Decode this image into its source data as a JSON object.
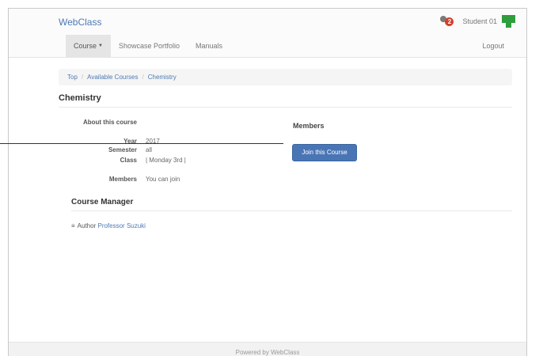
{
  "brand": "WebClass",
  "user": {
    "message_count": "2",
    "name": "Student 01"
  },
  "nav": {
    "course": "Course",
    "showcase": "Showcase Portfolio",
    "manuals": "Manuals",
    "logout": "Logout"
  },
  "breadcrumb": {
    "top": "Top",
    "sep": "/",
    "available": "Available Courses",
    "current": "Chemistry"
  },
  "course": {
    "title": "Chemistry",
    "about_label": "About this course",
    "year_label": "Year",
    "year": "2017",
    "semester_label": "Semester",
    "semester": "all",
    "class_label": "Class",
    "class": "| Monday 3rd |",
    "members_label": "Members",
    "members": "You can join"
  },
  "members_panel": {
    "heading": "Members",
    "join_button": "Join this Course"
  },
  "manager": {
    "heading": "Course Manager",
    "bullet": "≡",
    "role": "Author",
    "name": "Professor Suzuki"
  },
  "footer": "Powered by WebClass",
  "colors": {
    "link": "#4d79b4",
    "button": "#4a75b5",
    "badge": "#d2402e",
    "user_icon": "#2e9e3d"
  },
  "icons": {
    "messages": "chat-bubble-icon",
    "user": "user-puzzle-icon"
  }
}
